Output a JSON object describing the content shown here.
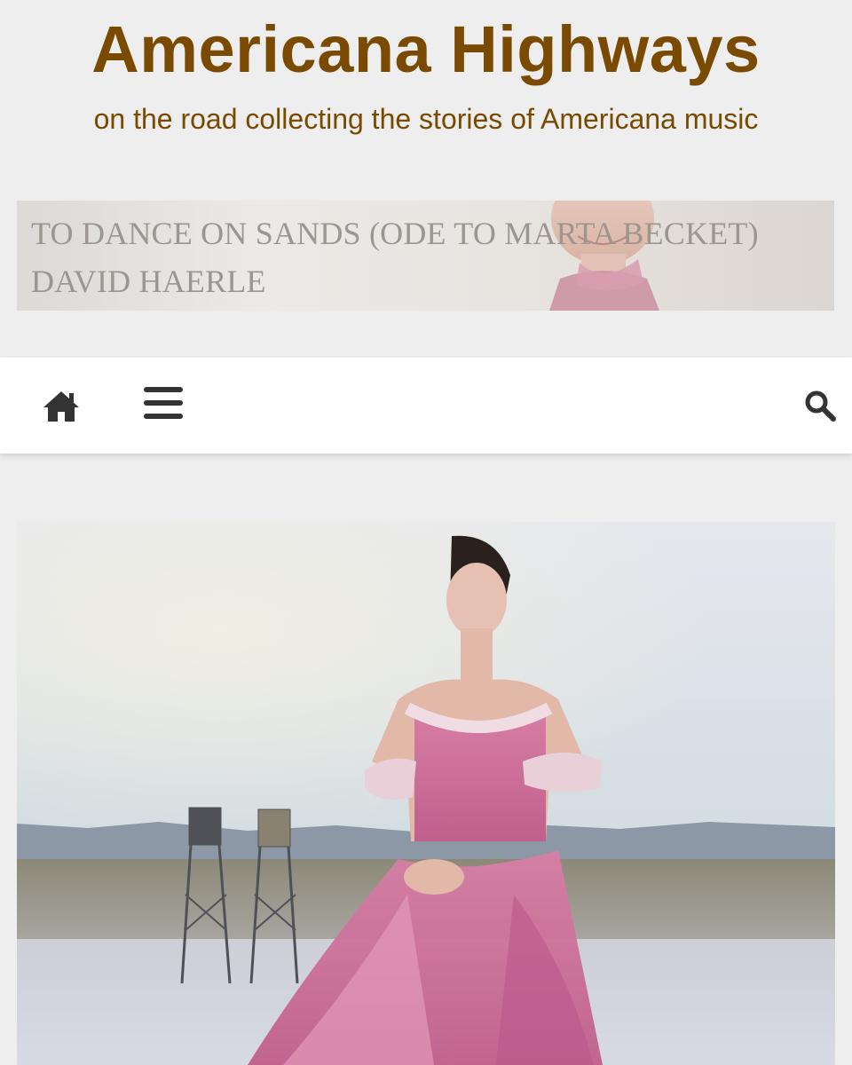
{
  "site": {
    "title": "Americana Highways",
    "tagline": "on the road collecting the stories of Americana music"
  },
  "banner": {
    "line1": "TO DANCE ON SANDS (ODE TO MARTA BECKET)",
    "line2": "DAVID HAERLE"
  },
  "nav": {
    "icons": [
      "home-icon",
      "menu-icon",
      "search-icon"
    ]
  },
  "colors": {
    "brand": "#7a4a00",
    "page_bg": "#eeeeee",
    "nav_bg": "#ffffff",
    "icon": "#333333"
  }
}
